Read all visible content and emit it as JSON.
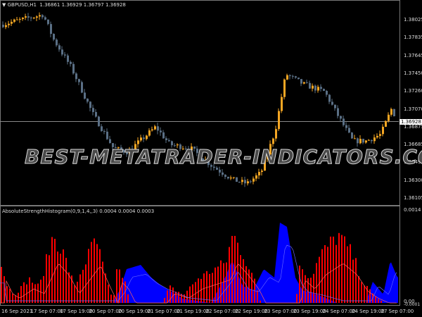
{
  "chart": {
    "symbol_header": "GBPUSD,H1",
    "ohlc": "1.36861 1.36929 1.36797 1.36928",
    "current_price": "1.36928",
    "price_axis": [
      "1.38025",
      "1.37835",
      "1.37645",
      "1.37450",
      "1.37260",
      "1.37070",
      "1.36875",
      "1.36685",
      "1.36495",
      "1.36300",
      "1.36105"
    ],
    "price_trend": [
      [
        0,
        1.3797
      ],
      [
        20,
        1.3801
      ],
      [
        60,
        1.3808
      ],
      [
        75,
        1.3781
      ],
      [
        100,
        1.3751
      ],
      [
        130,
        1.3702
      ],
      [
        160,
        1.3664
      ],
      [
        180,
        1.366
      ],
      [
        220,
        1.3687
      ],
      [
        240,
        1.3668
      ],
      [
        270,
        1.3664
      ],
      [
        300,
        1.3645
      ],
      [
        330,
        1.363
      ],
      [
        350,
        1.3626
      ],
      [
        370,
        1.3638
      ],
      [
        390,
        1.3683
      ],
      [
        405,
        1.3744
      ],
      [
        430,
        1.3733
      ],
      [
        460,
        1.3725
      ],
      [
        480,
        1.3698
      ],
      [
        500,
        1.3672
      ],
      [
        520,
        1.3672
      ],
      [
        540,
        1.3679
      ],
      [
        555,
        1.3706
      ],
      [
        565,
        1.3693
      ]
    ],
    "colors": {
      "bull": "#f5a623",
      "bear": "#5a6f85",
      "hist_red": "#ff0000",
      "hist_blue": "#0000ff"
    },
    "watermark": "BEST-METATRADER-INDICATORS.COM"
  },
  "indicator": {
    "label": "AbsoluteStrengthHistogram(0,9,1,4,,3) 0.0004 0.0004 0.0003",
    "axis_top": "0.0014",
    "axis_bottom": "0.00",
    "axis_bottom2": "-0.0001",
    "red_profile": [
      [
        0,
        0.5
      ],
      [
        10,
        0.2
      ],
      [
        20,
        0.1
      ],
      [
        40,
        0.3
      ],
      [
        55,
        0.2
      ],
      [
        75,
        0.85
      ],
      [
        90,
        0.6
      ],
      [
        105,
        0.2
      ],
      [
        125,
        0.6
      ],
      [
        135,
        0.8
      ],
      [
        150,
        0.3
      ],
      [
        160,
        0
      ],
      [
        165,
        0.45
      ],
      [
        175,
        0.3
      ],
      [
        185,
        0
      ],
      [
        230,
        0
      ],
      [
        240,
        0.2
      ],
      [
        260,
        0.1
      ],
      [
        280,
        0.3
      ],
      [
        300,
        0.4
      ],
      [
        320,
        0.5
      ],
      [
        330,
        0.85
      ],
      [
        345,
        0.6
      ],
      [
        360,
        0.3
      ],
      [
        370,
        0
      ],
      [
        420,
        0
      ],
      [
        425,
        0.5
      ],
      [
        440,
        0.3
      ],
      [
        455,
        0.6
      ],
      [
        480,
        0.85
      ],
      [
        500,
        0.6
      ],
      [
        515,
        0.25
      ],
      [
        530,
        0.1
      ],
      [
        545,
        0
      ]
    ],
    "blue_profile": [
      [
        0,
        0
      ],
      [
        160,
        0
      ],
      [
        170,
        0.15
      ],
      [
        180,
        0.4
      ],
      [
        200,
        0.45
      ],
      [
        215,
        0.3
      ],
      [
        230,
        0.2
      ],
      [
        260,
        0.05
      ],
      [
        300,
        0
      ],
      [
        320,
        0.3
      ],
      [
        330,
        0.5
      ],
      [
        345,
        0.2
      ],
      [
        360,
        0.15
      ],
      [
        375,
        0.4
      ],
      [
        390,
        0.3
      ],
      [
        398,
        0.95
      ],
      [
        408,
        0.9
      ],
      [
        420,
        0.3
      ],
      [
        430,
        0.15
      ],
      [
        450,
        0.1
      ],
      [
        480,
        0
      ],
      [
        520,
        0
      ],
      [
        530,
        0.25
      ],
      [
        545,
        0.1
      ],
      [
        555,
        0.5
      ],
      [
        565,
        0.3
      ]
    ],
    "time_axis": [
      "16 Sep 2021",
      "17 Sep 07:00",
      "17 Sep 19:00",
      "20 Sep 07:00",
      "20 Sep 19:00",
      "21 Sep 07:00",
      "21 Sep 19:00",
      "22 Sep 07:00",
      "22 Sep 19:00",
      "23 Sep 07:00",
      "23 Sep 19:00",
      "24 Sep 07:00",
      "24 Sep 19:00",
      "27 Sep 07:00"
    ]
  }
}
